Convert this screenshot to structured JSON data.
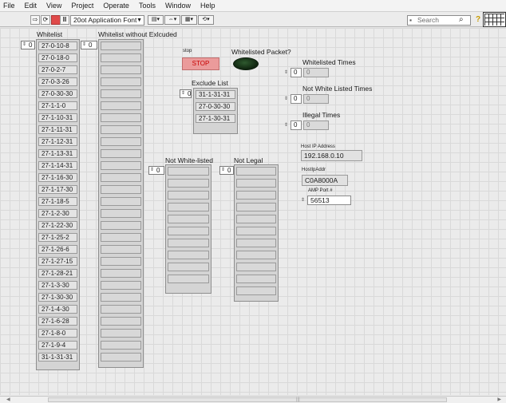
{
  "menu": [
    "File",
    "Edit",
    "View",
    "Project",
    "Operate",
    "Tools",
    "Window",
    "Help"
  ],
  "toolbar": {
    "font_label": "20ot Application Font",
    "search_placeholder": "Search"
  },
  "whitelist": {
    "label": "Whitelist",
    "index": "0",
    "items": [
      "27-0-10-8",
      "27-0-18-0",
      "27-0-2-7",
      "27-0-3-26",
      "27-0-30-30",
      "27-1-1-0",
      "27-1-10-31",
      "27-1-11-31",
      "27-1-12-31",
      "27-1-13-31",
      "27-1-14-31",
      "27-1-16-30",
      "27-1-17-30",
      "27-1-18-5",
      "27-1-2-30",
      "27-1-22-30",
      "27-1-25-2",
      "27-1-26-6",
      "27-1-27-15",
      "27-1-28-21",
      "27-1-3-30",
      "27-1-30-30",
      "27-1-4-30",
      "27-1-6-28",
      "27-1-8-0",
      "27-1-9-4",
      "31-1-31-31"
    ]
  },
  "whitelist_without_excluded": {
    "label": "Whitelist without Exlcuded",
    "index": "0"
  },
  "stop": {
    "caption": "stop",
    "button_label": "STOP"
  },
  "whitelisted_packet": {
    "label": "Whitelisted Packet?"
  },
  "exclude_list": {
    "label": "Exclude List",
    "index": "0",
    "items": [
      "31-1-31-31",
      "27-0-30-30",
      "27-1-30-31"
    ]
  },
  "whitelisted_times": {
    "label": "Whitelisted Times",
    "control": "0",
    "indicator": "0"
  },
  "not_whitelisted_times": {
    "label": "Not White Listed Times",
    "control": "0",
    "indicator": "0"
  },
  "illegal_times": {
    "label": "Illegal Times",
    "control": "0",
    "indicator": "0"
  },
  "host_ip": {
    "label": "Host IP Address",
    "value": "192.168.0.10"
  },
  "host_ip_addr": {
    "label": "HostIpAddr",
    "value": "C0A8000A"
  },
  "amp_port": {
    "label": "AMP Port #",
    "value": "56513"
  },
  "not_whitelisted": {
    "label": "Not White-listed",
    "index": "0"
  },
  "not_legal": {
    "label": "Not Legal",
    "index": "0"
  }
}
